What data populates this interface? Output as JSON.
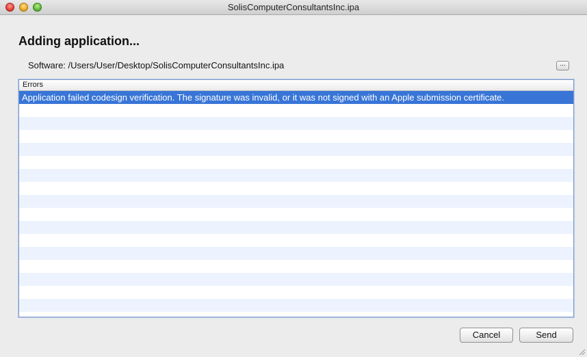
{
  "window": {
    "title": "SolisComputerConsultantsInc.ipa"
  },
  "heading": "Adding application...",
  "software": {
    "label": "Software:",
    "path": "/Users/User/Desktop/SolisComputerConsultantsInc.ipa",
    "browse_label": "..."
  },
  "errors_table": {
    "header": "Errors",
    "rows": [
      "Application failed codesign verification.  The signature was invalid, or it was not signed with an Apple submission certificate."
    ],
    "selected_row_color": "#3875d7",
    "stripe_color": "#edf3fe"
  },
  "buttons": {
    "cancel_label": "Cancel",
    "send_label": "Send"
  }
}
